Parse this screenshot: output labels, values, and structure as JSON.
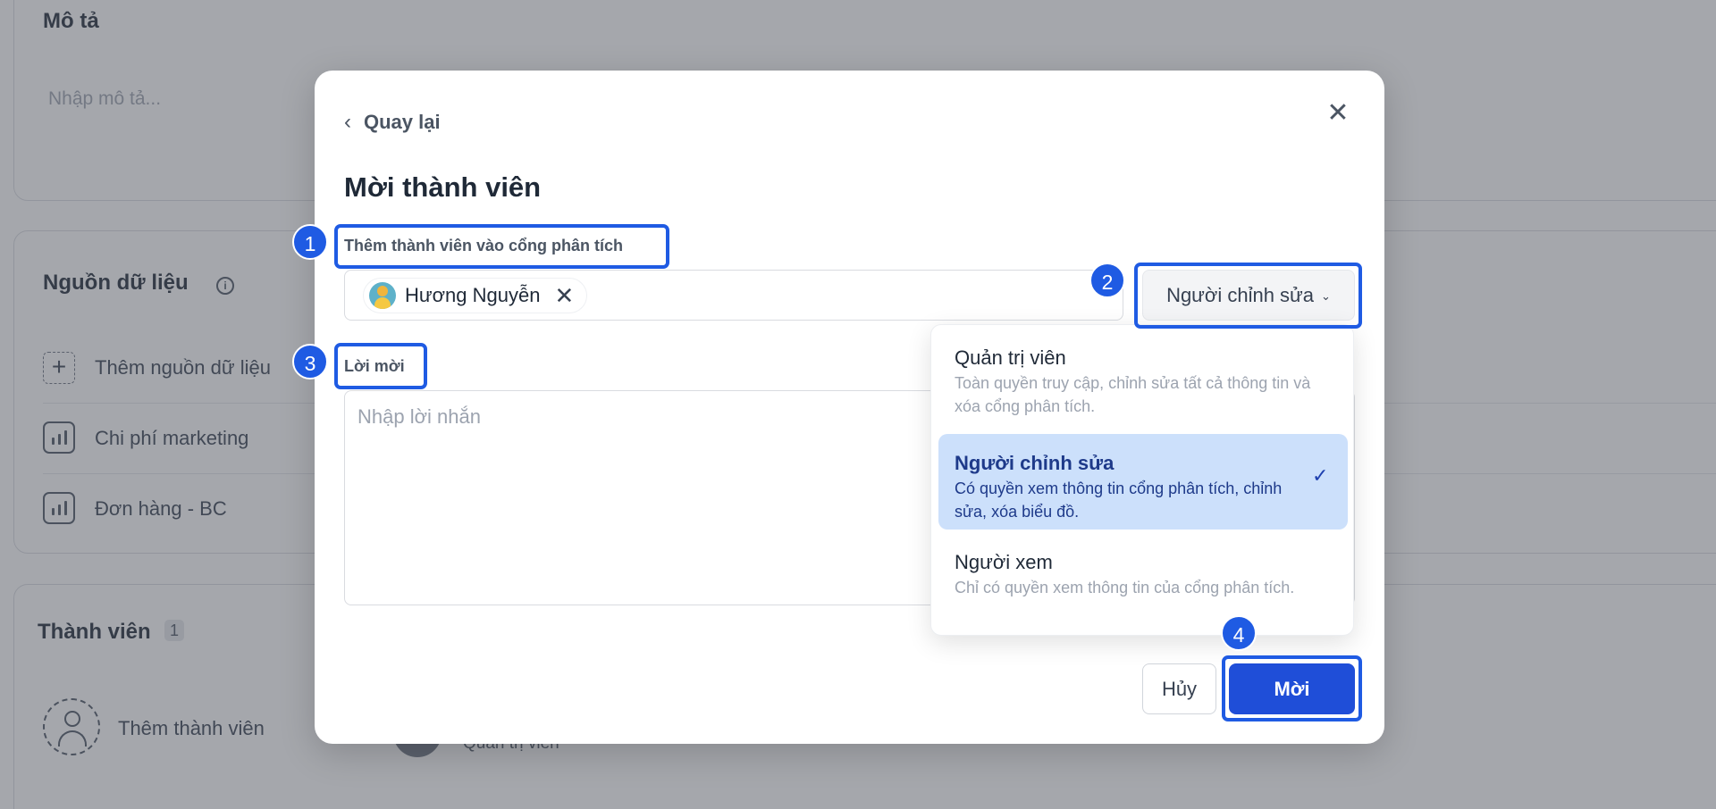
{
  "background": {
    "description_card": {
      "title": "Mô tả",
      "placeholder": "Nhập mô tả..."
    },
    "data_sources_card": {
      "title": "Nguồn dữ liệu",
      "info_icon": "info-icon",
      "add_label": "Thêm nguồn dữ liệu",
      "items": [
        {
          "label": "Chi phí marketing",
          "icon": "bar-chart-icon"
        },
        {
          "label": "Đơn hàng - BC",
          "icon": "bar-chart-icon"
        }
      ]
    },
    "members_card": {
      "title": "Thành viên",
      "count": "1",
      "add_label": "Thêm thành viên",
      "member_role": "Quản trị viên"
    }
  },
  "modal": {
    "back_label": "Quay lại",
    "title": "Mời thành viên",
    "add_members_label": "Thêm thành viên vào cổng phân tích",
    "selected_member": {
      "name": "Hương Nguyễn",
      "remove_icon": "close-icon"
    },
    "role_select": {
      "value": "Người chỉnh sửa"
    },
    "message_label": "Lời mời",
    "message_placeholder": "Nhập lời nhắn",
    "cancel_label": "Hủy",
    "invite_label": "Mời"
  },
  "role_dropdown": {
    "options": [
      {
        "title": "Quản trị viên",
        "description": "Toàn quyền truy cập, chỉnh sửa tất cả thông tin và xóa cổng phân tích.",
        "selected": false
      },
      {
        "title": "Người chỉnh sửa",
        "description": "Có quyền xem thông tin cổng phân tích, chỉnh sửa, xóa biểu đồ.",
        "selected": true
      },
      {
        "title": "Người xem",
        "description": "Chỉ có quyền xem thông tin của cổng phân tích.",
        "selected": false
      }
    ]
  },
  "annotations": [
    "1",
    "2",
    "3",
    "4"
  ],
  "colors": {
    "accent": "#1f4ed8",
    "annotation": "#1f5be3",
    "selected_option_bg": "#cce0fb",
    "overlay": "rgba(75,80,90,0.5)"
  }
}
